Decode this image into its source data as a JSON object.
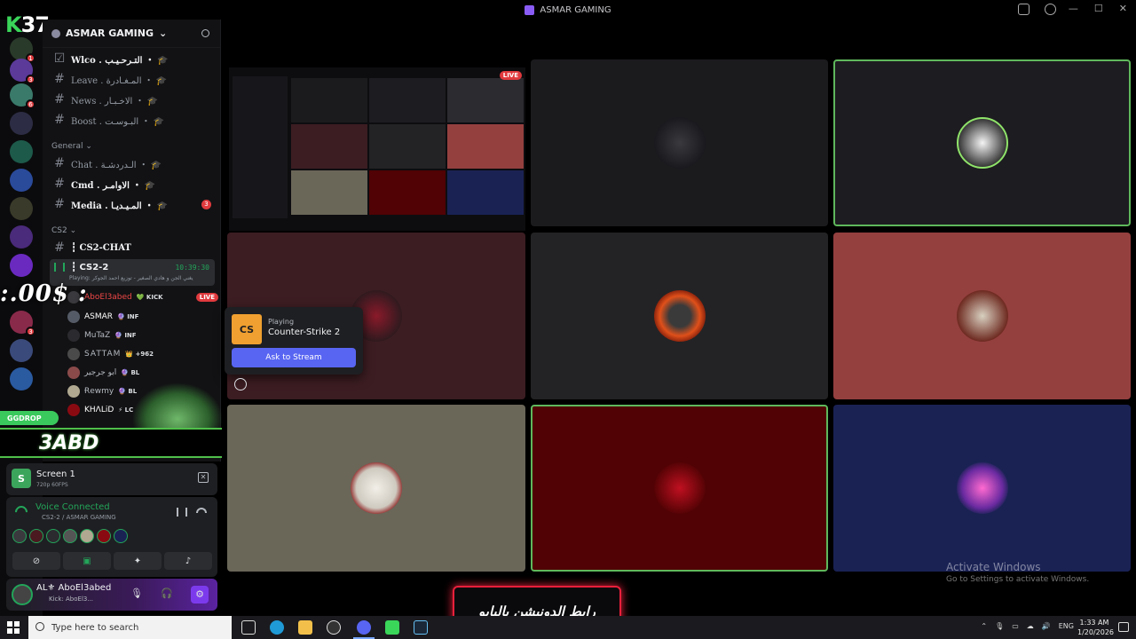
{
  "window": {
    "title": "ASMAR GAMING",
    "controls": [
      "—",
      "☐",
      "✕"
    ]
  },
  "overlay": {
    "logo": "K",
    "logo_num": "37",
    "money_text": ":.00$ :",
    "ggdrop": "GGDROP",
    "abd": "3ABD",
    "promo_text": "رابط الدونيشن بالبايو"
  },
  "rail": {
    "badges": [
      "1",
      "3",
      "6",
      "3"
    ]
  },
  "sidebar": {
    "guild_name": "ASMAR GAMING",
    "channels_top": [
      {
        "name": "Wlco . التـرحـيـب ・ 🎓",
        "unread": ""
      },
      {
        "name": "Leave . المـغـادرة ・ 🎓",
        "unread": ""
      },
      {
        "name": "News . الاخـبـار ・ 🎓",
        "unread": ""
      },
      {
        "name": "Boost . البـوسـت ・ 🎓",
        "unread": ""
      }
    ],
    "category_general": "General",
    "channels_general": [
      {
        "name": "Chat . الـدردشـة ・ 🎓",
        "unread": ""
      },
      {
        "name": "Cmd . الاوامـر ・ 🎓",
        "unread": ""
      },
      {
        "name": "Media . المـيـديـا ・ 🎓",
        "unread": "3"
      }
    ],
    "category_cs2": "CS2",
    "cs2_chat": "┇ CS2-CHAT",
    "voice_channel": {
      "name": "┇ CS2-2",
      "time": "10:39:30",
      "playing": "Playing: يغني الجن و هادي الصغير - توزيع احمد الجوكر"
    },
    "voice_users": [
      {
        "name": "AboEl3abed",
        "tag": "💚 KICK",
        "live": "LIVE"
      },
      {
        "name": "ASMAR",
        "tag": "🔮 INF",
        "live": ""
      },
      {
        "name": "MuTaZ",
        "tag": "🔮 INF",
        "live": ""
      },
      {
        "name": "SATTAM",
        "tag": "👑 +962",
        "live": ""
      },
      {
        "name": "ابو جرجير",
        "tag": "🔮 BL",
        "live": ""
      },
      {
        "name": "Ɍewmy",
        "tag": "🔮 BL",
        "live": ""
      },
      {
        "name": "KHΛLiD",
        "tag": "⚡ LC",
        "live": ""
      }
    ]
  },
  "screen_panel": {
    "title": "Screen 1",
    "subtitle": "720p 60FPS"
  },
  "voice_panel": {
    "status": "Voice Connected",
    "location": "CS2-2 / ASMAR GAMING"
  },
  "user_panel": {
    "name": "AL⚜ AboEl3abed",
    "status": "Kick: AboEl3..."
  },
  "popup": {
    "label": "Playing",
    "game": "Counter-Strike 2",
    "button": "Ask to Stream",
    "game_abbr": "CS"
  },
  "stage": {
    "live_label": "LIVE",
    "tiles": [
      {
        "name": "tile-asmar-logo",
        "bg": "#1b1a1d",
        "avatar": "#2a2a2e",
        "speaking": false
      },
      {
        "name": "tile-skull",
        "bg": "#1d1c20",
        "avatar": "#e8e8e8",
        "speaking": true
      },
      {
        "name": "tile-red-bandana",
        "bg": "#3c1d22",
        "avatar": "#5a2a30",
        "speaking": false
      },
      {
        "name": "tile-fire",
        "bg": "#232325",
        "avatar": "#d4401a",
        "speaking": false
      },
      {
        "name": "tile-grad-cap",
        "bg": "#94403f",
        "avatar": "#6e2a20",
        "speaking": false
      },
      {
        "name": "tile-skull-face",
        "bg": "#6a6658",
        "avatar": "#e8e4dc",
        "speaking": false
      },
      {
        "name": "tile-khalid",
        "bg": "#500204",
        "avatar": "#8a0a12",
        "speaking": true
      },
      {
        "name": "tile-neon",
        "bg": "#1a2254",
        "avatar": "#b23bb0",
        "speaking": false
      }
    ]
  },
  "watermark": {
    "line1": "Activate Windows",
    "line2": "Go to Settings to activate Windows."
  },
  "taskbar": {
    "search_placeholder": "Type here to search",
    "lang": "ENG",
    "time": "1:33 AM",
    "date": "1/20/2026"
  }
}
